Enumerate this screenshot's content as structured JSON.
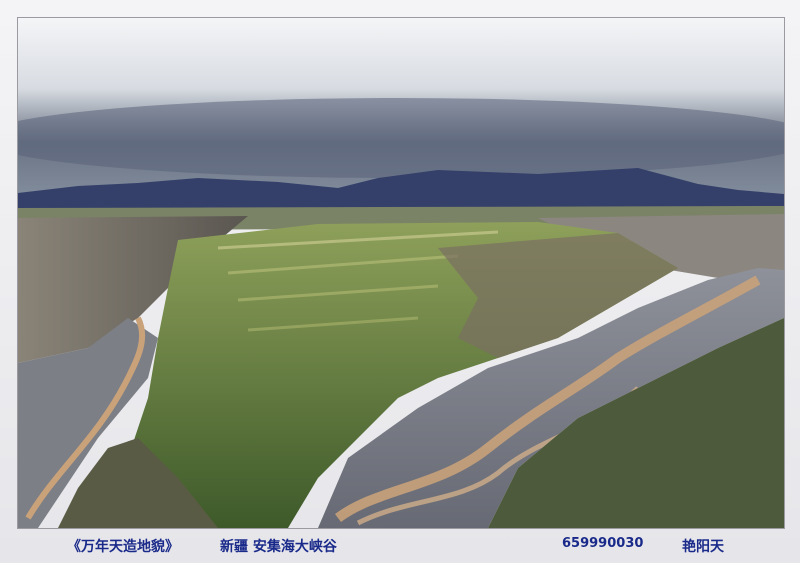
{
  "caption": {
    "title": "《万年天造地貌》",
    "location": "新疆 安集海大峡谷",
    "number": "659990030",
    "author": "艳阳天"
  },
  "colors": {
    "caption_text": "#1a2a8a",
    "sky_top": "#f2f3f5",
    "sky_clouds": "#5f6a78",
    "mountains": "#34406a",
    "grass": "#5e7a3c",
    "riverbed": "#7a7d86",
    "river_water": "#c9a27a"
  }
}
